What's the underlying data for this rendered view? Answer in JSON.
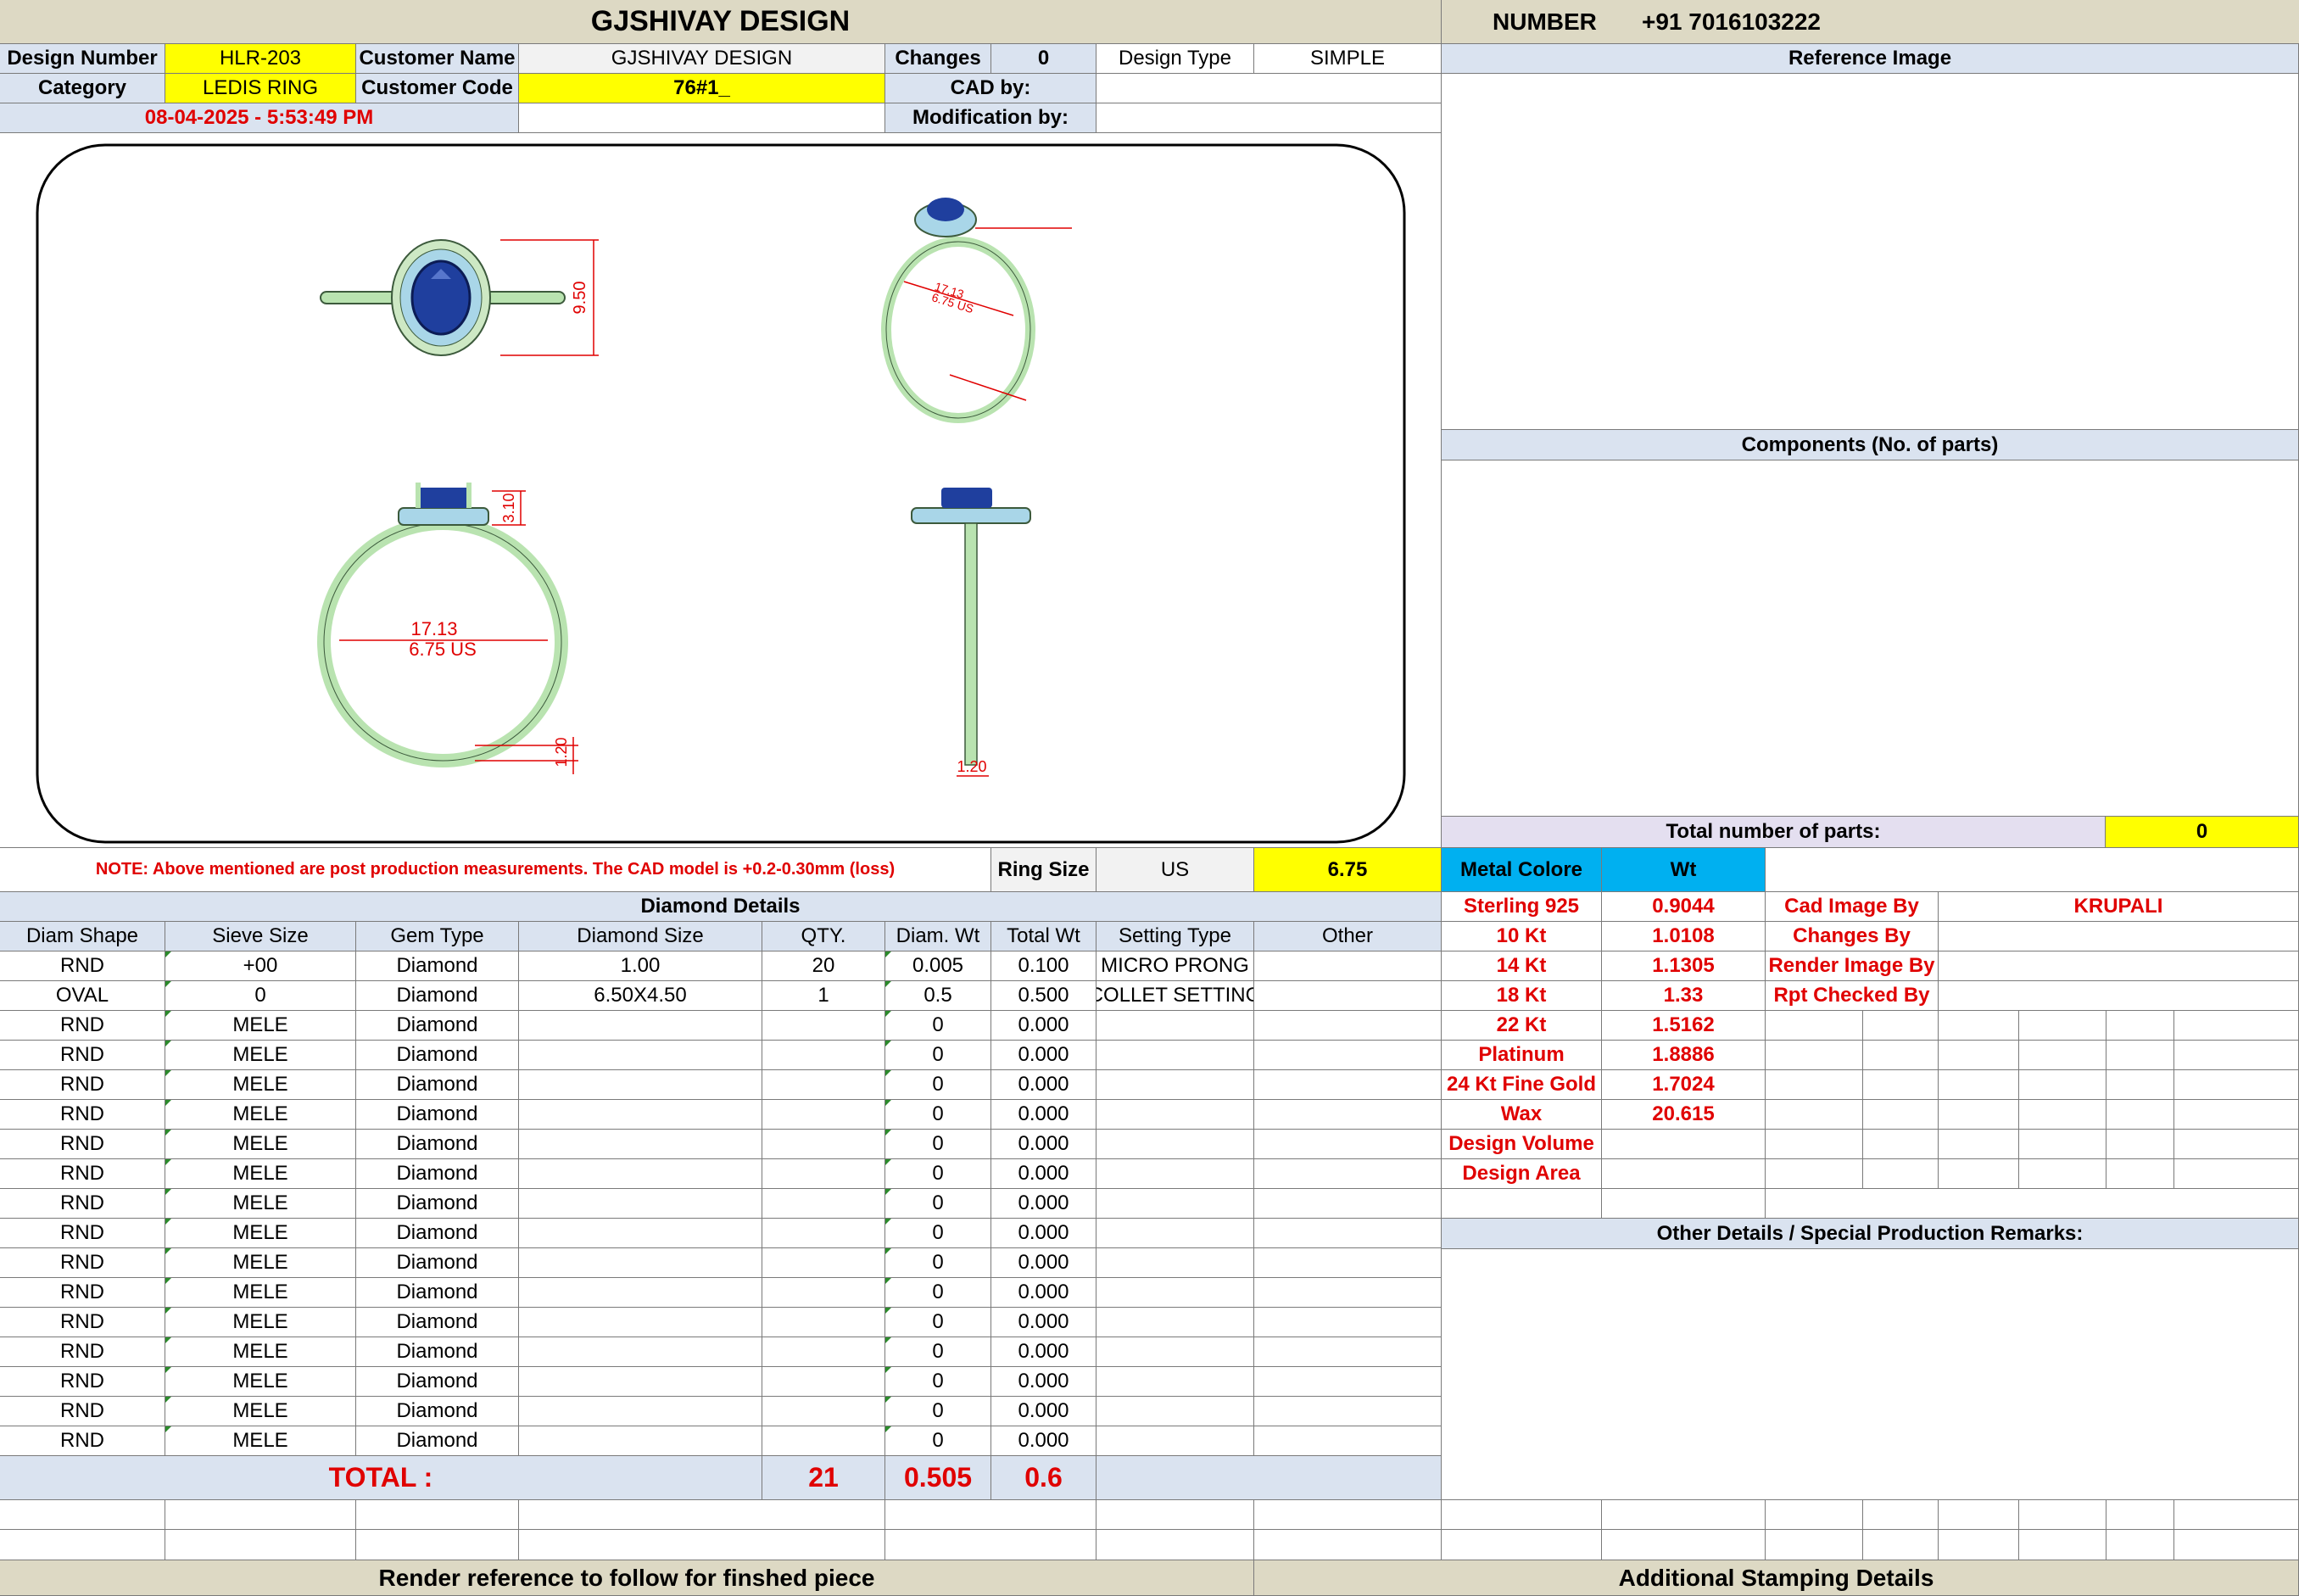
{
  "header": {
    "title": "GJSHIVAY DESIGN",
    "number_label": "NUMBER",
    "number_value": "+91 7016103222"
  },
  "info": {
    "design_number_label": "Design Number",
    "design_number": "HLR-203",
    "customer_name_label": "Customer Name",
    "customer_name": "GJSHIVAY DESIGN",
    "changes_label": "Changes",
    "changes": "0",
    "design_type_label": "Design Type",
    "design_type": "SIMPLE",
    "category_label": "Category",
    "category": "LEDIS RING",
    "customer_code_label": "Customer Code",
    "customer_code": "76#1_",
    "cad_by_label": "CAD by:",
    "timestamp": "08-04-2025 - 5:53:49 PM",
    "modification_by_label": "Modification by:"
  },
  "drawing": {
    "dim_top_height": "9.50",
    "dim_front_width": "17.13",
    "dim_front_size": "6.75 US",
    "dim_front_head": "3.10",
    "dim_front_shank": "1.20",
    "dim_side_shank": "1.20",
    "dim_persp_width": "17.13",
    "dim_persp_size": "6.75 US"
  },
  "note": "NOTE: Above mentioned are post production measurements. The CAD model is +0.2-0.30mm (loss)",
  "ring_size": {
    "label": "Ring Size",
    "unit": "US",
    "value": "6.75"
  },
  "diamond": {
    "title": "Diamond Details",
    "headers": [
      "Diam Shape",
      "Sieve Size",
      "Gem Type",
      "Diamond Size",
      "QTY.",
      "Diam. Wt",
      "Total Wt",
      "Setting Type",
      "Other"
    ],
    "rows": [
      [
        "RND",
        "+00",
        "Diamond",
        "1.00",
        "20",
        "0.005",
        "0.100",
        "MICRO PRONG",
        ""
      ],
      [
        "OVAL",
        "0",
        "Diamond",
        "6.50X4.50",
        "1",
        "0.5",
        "0.500",
        "COLLET SETTING",
        ""
      ],
      [
        "RND",
        "MELE",
        "Diamond",
        "",
        "",
        "0",
        "0.000",
        "",
        ""
      ],
      [
        "RND",
        "MELE",
        "Diamond",
        "",
        "",
        "0",
        "0.000",
        "",
        ""
      ],
      [
        "RND",
        "MELE",
        "Diamond",
        "",
        "",
        "0",
        "0.000",
        "",
        ""
      ],
      [
        "RND",
        "MELE",
        "Diamond",
        "",
        "",
        "0",
        "0.000",
        "",
        ""
      ],
      [
        "RND",
        "MELE",
        "Diamond",
        "",
        "",
        "0",
        "0.000",
        "",
        ""
      ],
      [
        "RND",
        "MELE",
        "Diamond",
        "",
        "",
        "0",
        "0.000",
        "",
        ""
      ],
      [
        "RND",
        "MELE",
        "Diamond",
        "",
        "",
        "0",
        "0.000",
        "",
        ""
      ],
      [
        "RND",
        "MELE",
        "Diamond",
        "",
        "",
        "0",
        "0.000",
        "",
        ""
      ],
      [
        "RND",
        "MELE",
        "Diamond",
        "",
        "",
        "0",
        "0.000",
        "",
        ""
      ],
      [
        "RND",
        "MELE",
        "Diamond",
        "",
        "",
        "0",
        "0.000",
        "",
        ""
      ],
      [
        "RND",
        "MELE",
        "Diamond",
        "",
        "",
        "0",
        "0.000",
        "",
        ""
      ],
      [
        "RND",
        "MELE",
        "Diamond",
        "",
        "",
        "0",
        "0.000",
        "",
        ""
      ],
      [
        "RND",
        "MELE",
        "Diamond",
        "",
        "",
        "0",
        "0.000",
        "",
        ""
      ],
      [
        "RND",
        "MELE",
        "Diamond",
        "",
        "",
        "0",
        "0.000",
        "",
        ""
      ],
      [
        "RND",
        "MELE",
        "Diamond",
        "",
        "",
        "0",
        "0.000",
        "",
        ""
      ]
    ],
    "total_label": "TOTAL :",
    "total_qty": "21",
    "total_diam_wt": "0.505",
    "total_wt": "0.6"
  },
  "right": {
    "reference_image": "Reference Image",
    "components": "Components (No. of parts)",
    "total_parts_label": "Total number of parts:",
    "total_parts": "0",
    "metal_colore": "Metal Colore",
    "wt": "Wt",
    "metals": [
      {
        "name": "Sterling 925",
        "wt": "0.9044"
      },
      {
        "name": "10 Kt",
        "wt": "1.0108"
      },
      {
        "name": "14 Kt",
        "wt": "1.1305"
      },
      {
        "name": "18 Kt",
        "wt": "1.33"
      },
      {
        "name": "22 Kt",
        "wt": "1.5162"
      },
      {
        "name": "Platinum",
        "wt": "1.8886"
      },
      {
        "name": "24 Kt Fine Gold",
        "wt": "1.7024"
      },
      {
        "name": "Wax",
        "wt": "20.615"
      },
      {
        "name": "Design Volume",
        "wt": ""
      },
      {
        "name": "Design Area",
        "wt": ""
      }
    ],
    "credits": [
      {
        "label": "Cad Image By",
        "value": "KRUPALI"
      },
      {
        "label": "Changes By",
        "value": ""
      },
      {
        "label": "Render Image By",
        "value": ""
      },
      {
        "label": "Rpt Checked By",
        "value": ""
      }
    ],
    "other_details": "Other Details / Special Production Remarks:"
  },
  "footer": {
    "render_reference": "Render reference to follow for finshed piece",
    "stamping": "Additional Stamping Details"
  },
  "colors": {
    "ring_metal": "#b9e3b0",
    "gem_blue": "#1f3f9e",
    "dimension_red": "#e00000",
    "header_tan": "#ddd9c4",
    "label_blue": "#dae3f0",
    "highlight_yellow": "#ffff00",
    "metal_header_cyan": "#00b0f0"
  }
}
